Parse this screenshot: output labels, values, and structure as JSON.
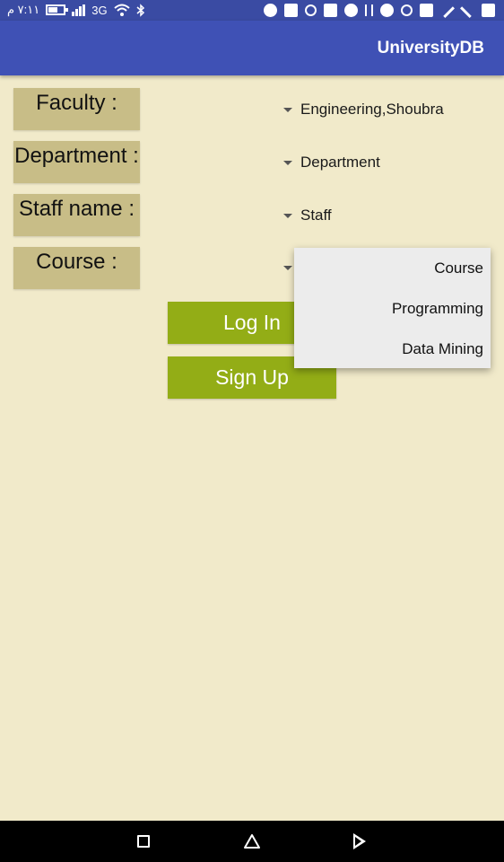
{
  "status_bar": {
    "time": "٧:١١ م",
    "network": "3G",
    "battery_level": 0.55,
    "icons": [
      "battery-icon",
      "signal-icon",
      "wifi-icon",
      "bluetooth-icon",
      "clock-icon",
      "mail-icon",
      "chrome-icon",
      "lock-icon",
      "messenger-icon",
      "usb-icon",
      "globe-icon",
      "whatsapp-icon",
      "image-icon",
      "wrench-icon",
      "wrench2-icon",
      "facebook-icon"
    ]
  },
  "app_bar": {
    "title": "UniversityDB"
  },
  "form": {
    "faculty": {
      "label": "Faculty :",
      "value": "Engineering,Shoubra"
    },
    "department": {
      "label": "Department :",
      "value": "Department"
    },
    "staff": {
      "label": "Staff name :",
      "value": "Staff"
    },
    "course": {
      "label": "Course :"
    }
  },
  "course_dropdown": {
    "options": [
      "Course",
      "Programming",
      "Data Mining"
    ]
  },
  "buttons": {
    "login": "Log In",
    "signup": "Sign Up"
  },
  "colors": {
    "app_bar": "#3f51b5",
    "background": "#f1eaca",
    "label_bg": "#c8bd87",
    "button_bg": "#93ad16",
    "dropdown_bg": "#ececec"
  }
}
